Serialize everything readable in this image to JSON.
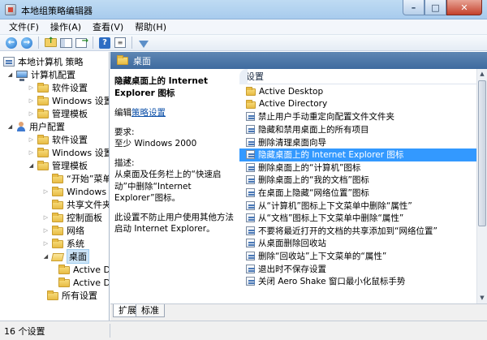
{
  "window": {
    "title": "本地组策略编辑器",
    "buttons": {
      "minimize": "–",
      "maximize": "□",
      "close": "✕"
    }
  },
  "menu": [
    "文件(F)",
    "操作(A)",
    "查看(V)",
    "帮助(H)"
  ],
  "tree": {
    "root": "本地计算机 策略",
    "computer_config": "计算机配置",
    "cc_software": "软件设置",
    "cc_windows": "Windows 设置",
    "cc_admin": "管理模板",
    "user_config": "用户配置",
    "uc_software": "软件设置",
    "uc_windows": "Windows 设置",
    "uc_admin": "管理模板",
    "start_menu": "“开始”菜单和任务栏",
    "win_components": "Windows 组件",
    "shared_folders": "共享文件夹",
    "control_panel": "控制面板",
    "network": "网络",
    "system": "系统",
    "desktop": "桌面",
    "active_desktop": "Active Desktop",
    "active_directory": "Active Directory",
    "all_settings": "所有设置"
  },
  "content": {
    "header_title": "桌面",
    "desc_title": "隐藏桌面上的 Internet Explorer 图标",
    "edit_prefix": "编辑",
    "edit_link": "策略设置",
    "req_label": "要求:",
    "req_value": "至少 Windows 2000",
    "desc_label": "描述:",
    "desc_text": "从桌面及任务栏上的“快速启动”中删除“Internet Explorer”图标。",
    "desc_note": "此设置不防止用户使用其他方法启动 Internet Explorer。",
    "list_header": "设置",
    "rows": [
      "Active Desktop",
      "Active Directory",
      "禁止用户手动重定向配置文件文件夹",
      "隐藏和禁用桌面上的所有项目",
      "删除清理桌面向导",
      "隐藏桌面上的 Internet Explorer 图标",
      "删除桌面上的“计算机”图标",
      "删除桌面上的“我的文档”图标",
      "在桌面上隐藏“网络位置”图标",
      "从“计算机”图标上下文菜单中删除“属性”",
      "从“文档”图标上下文菜单中删除“属性”",
      "不要将最近打开的文档的共享添加到“网络位置”",
      "从桌面删除回收站",
      "删除“回收站”上下文菜单的“属性”",
      "退出时不保存设置",
      "关闭 Aero Shake 窗口最小化鼠标手势"
    ]
  },
  "tabs": [
    "扩展",
    "标准"
  ],
  "status": "16 个设置"
}
